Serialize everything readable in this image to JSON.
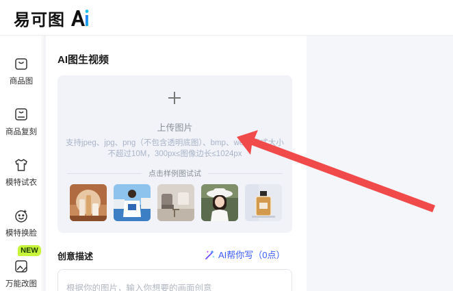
{
  "header": {
    "logo_text": "易可图",
    "logo_ai": "Ai"
  },
  "sidebar": {
    "items": [
      {
        "label": "商品图",
        "icon": "shopping-bag-icon"
      },
      {
        "label": "商品复刻",
        "icon": "bag-copy-icon"
      },
      {
        "label": "模特试衣",
        "icon": "shirt-icon"
      },
      {
        "label": "模特换脸",
        "icon": "face-swap-icon"
      },
      {
        "label": "万能改图",
        "icon": "image-edit-icon"
      }
    ],
    "new_badge": "NEW"
  },
  "panel": {
    "title": "AI图生视频",
    "upload": {
      "label": "上传图片",
      "hint": "支持jpeg、jpg、png（不包含透明底图）、bmp、webp格式大小不超过10M，300px≤图像边长≤1024px",
      "sample_label": "点击样例图试试",
      "samples": [
        "cosmetics-sample",
        "beach-tshirt-sample",
        "chairs-sample",
        "girl-hat-sample",
        "perfume-sample"
      ]
    },
    "description": {
      "title": "创意描述",
      "ai_help": "AI帮你写（0点）",
      "placeholder": "根据你的图片，输入你想要的画面创意"
    }
  },
  "colors": {
    "accent": "#3a5bff",
    "arrow": "#f04a4a",
    "badge": "#c8f53c"
  }
}
